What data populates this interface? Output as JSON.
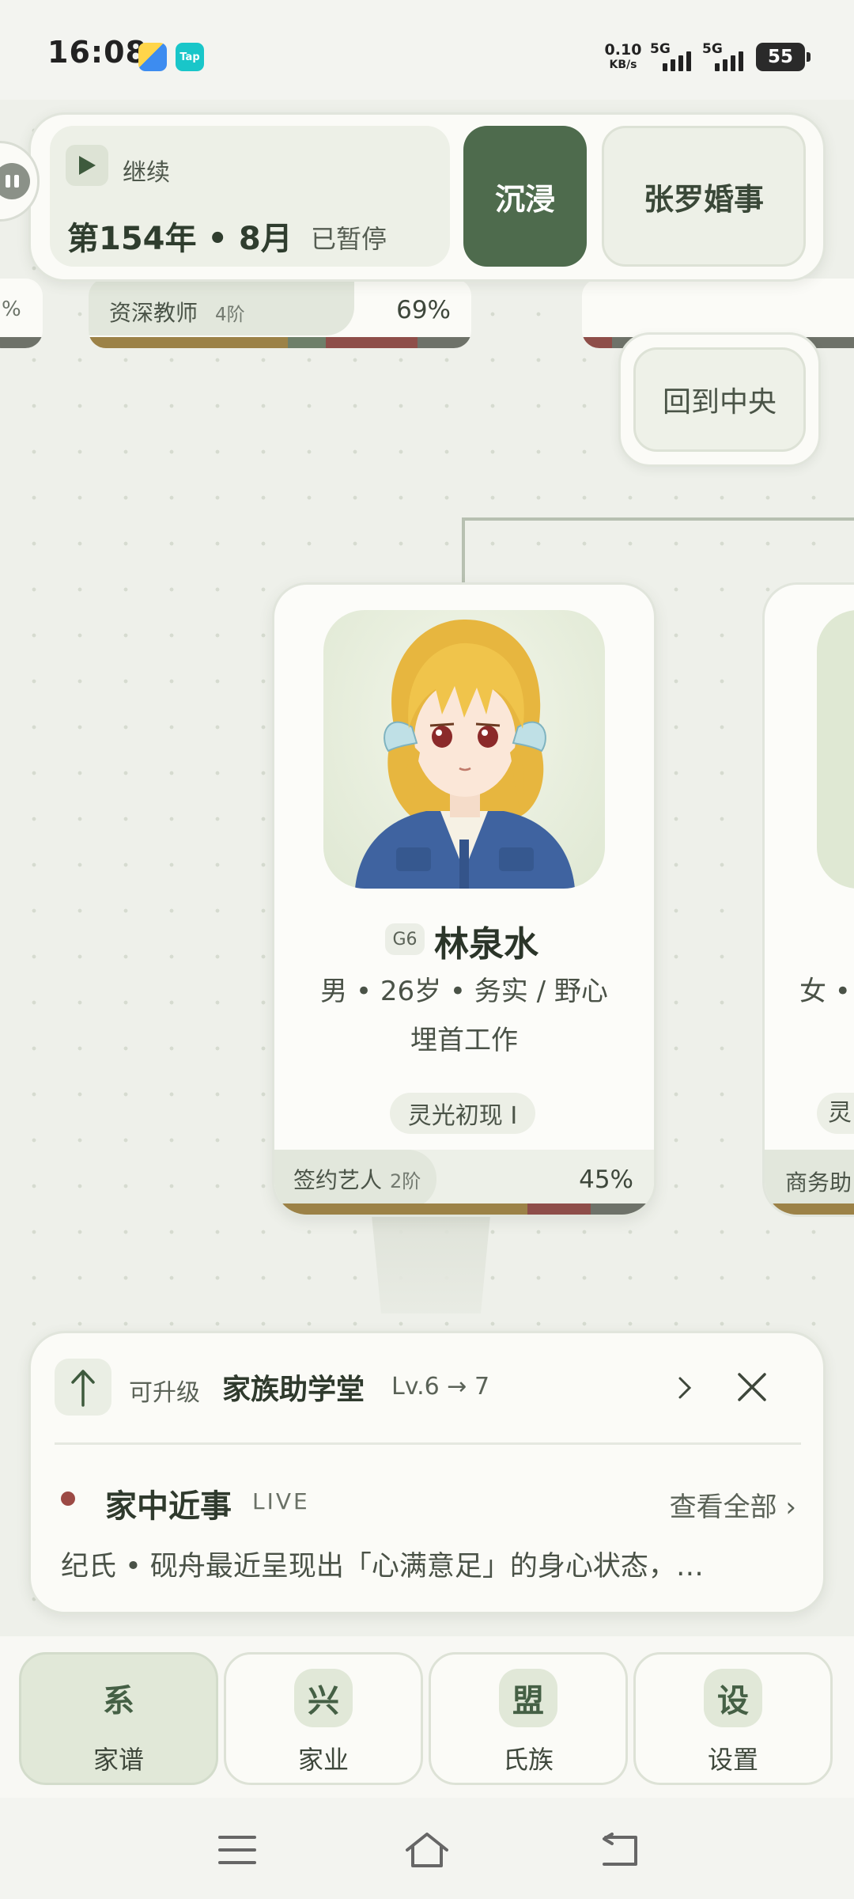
{
  "status_bar": {
    "time": "16:08",
    "net_speed": "0.10",
    "net_unit": "KB/s",
    "signal1": "5G",
    "signal2": "5G",
    "battery": "55"
  },
  "control": {
    "continue_label": "继续",
    "year_text": "第154年 • 8月",
    "paused_text": "已暂停",
    "immerse_label": "沉浸",
    "event_label": "张罗婚事",
    "recenter_label": "回到中央"
  },
  "background_cards": {
    "left_pct": "%",
    "mid_role": "资深教师",
    "mid_level": "4阶",
    "mid_pct": "69%"
  },
  "person": {
    "generation": "G6",
    "name": "林泉水",
    "info": "男 • 26岁 • 务实 / 野心",
    "job": "埋首工作",
    "talent": "灵光初现 Ⅰ",
    "role": "签约艺人",
    "role_level": "2阶",
    "progress": "45%",
    "bar_colors": [
      "#9c8247",
      "#9c8247",
      "#9c8247",
      "#9c8247",
      "#8e4e49",
      "#6e7269"
    ]
  },
  "side_person": {
    "info": "女 •",
    "talent": "灵",
    "role": "商务助"
  },
  "notice": {
    "upgrade_label": "可升级",
    "upgrade_name": "家族助学堂",
    "upgrade_level": "Lv.6 → 7",
    "news_title": "家中近事",
    "live_badge": "LIVE",
    "view_all": "查看全部 ›",
    "news_text": "纪氏 • 砚舟最近呈现出「心满意足」的身心状态，…"
  },
  "nav": [
    {
      "icon": "系",
      "label": "家谱",
      "active": true
    },
    {
      "icon": "兴",
      "label": "家业",
      "active": false
    },
    {
      "icon": "盟",
      "label": "氏族",
      "active": false
    },
    {
      "icon": "设",
      "label": "设置",
      "active": false
    }
  ],
  "colors": {
    "accent": "#4e6b4d",
    "background": "#eef0ea",
    "live_dot": "#9c4a45"
  }
}
